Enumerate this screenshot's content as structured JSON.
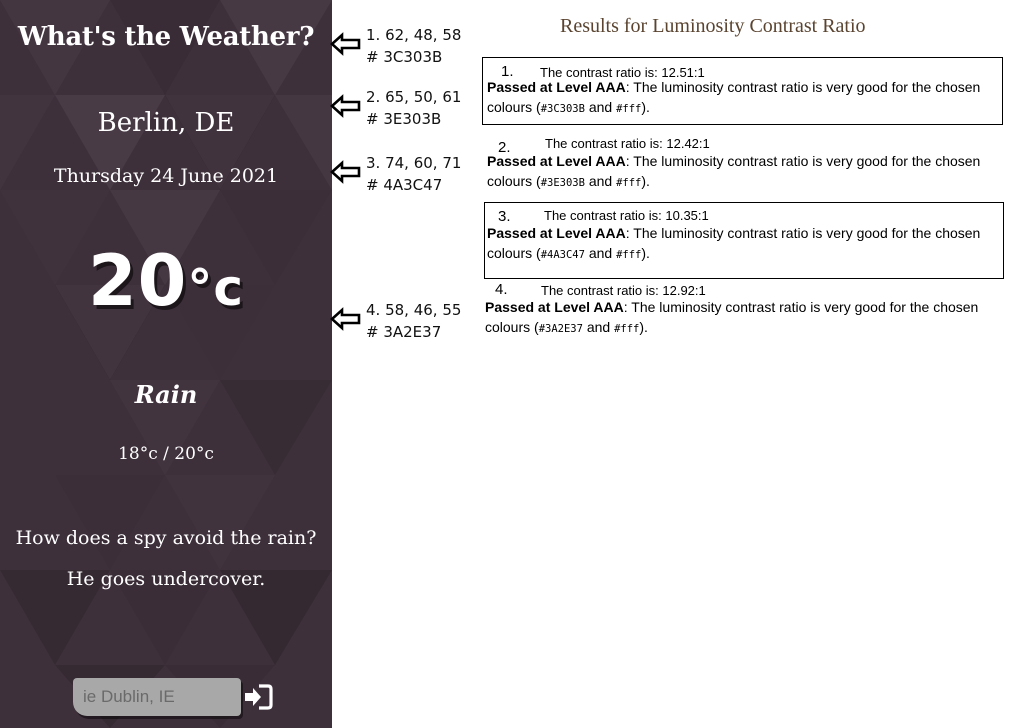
{
  "app": {
    "title": "What's the Weather?",
    "city": "Berlin, DE",
    "date": "Thursday 24 June 2021",
    "temperature": "20",
    "temp_unit": "°c",
    "condition": "Rain",
    "min_max": "18°c / 20°c",
    "joke": "How does a spy avoid the rain? He goes undercover.",
    "search_placeholder": "ie Dublin, IE",
    "search_icon": "sign-in-icon",
    "background_color": "#3E303B"
  },
  "swatches": [
    {
      "rgb": "1. 62, 48, 58",
      "hex": "# 3C303B",
      "icon": "left-arrow-icon"
    },
    {
      "rgb": "2. 65, 50, 61",
      "hex": "# 3E303B",
      "icon": "left-arrow-icon"
    },
    {
      "rgb": "3. 74, 60, 71",
      "hex": "# 4A3C47",
      "icon": "left-arrow-icon"
    },
    {
      "rgb": "4. 58, 46, 55",
      "hex": "# 3A2E37",
      "icon": "left-arrow-icon"
    }
  ],
  "results": {
    "title": "Results for Luminosity Contrast Ratio",
    "passed_label": "Passed at Level AAA",
    "message": ": The luminosity contrast ratio is very good for the chosen colours (",
    "and_text": " and ",
    "close_text": ").",
    "fg_code": "#fff",
    "items": [
      {
        "num": "1.",
        "ratio": "The contrast ratio is: 12.51:1",
        "bg_code": "#3C303B"
      },
      {
        "num": "2.",
        "ratio": "The contrast ratio is: 12.42:1",
        "bg_code": "#3E303B"
      },
      {
        "num": "3.",
        "ratio": "The contrast ratio is: 10.35:1",
        "bg_code": "#4A3C47"
      },
      {
        "num": "4.",
        "ratio": "The contrast ratio is: 12.92:1",
        "bg_code": "#3A2E37"
      }
    ]
  }
}
